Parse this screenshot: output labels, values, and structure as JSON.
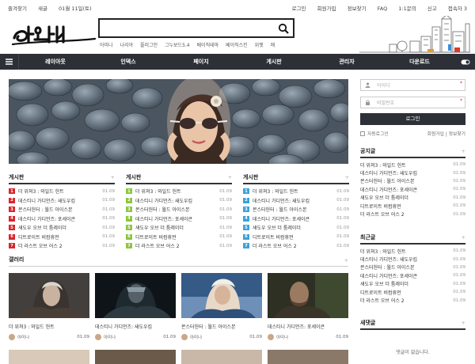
{
  "topbar": {
    "left": [
      "즐겨찾기",
      "새글",
      "01월 11일(토)"
    ],
    "right": [
      "로그인",
      "회원가입",
      "정보찾기",
      "FAQ",
      "1:1문의",
      "신고",
      "접속자 3"
    ]
  },
  "header": {
    "logo_text": "아미나",
    "keywords": [
      "아미나",
      "나리야",
      "플러그인",
      "그누보드5.4",
      "베이직테마",
      "베이직스킨",
      "위젯",
      "애"
    ]
  },
  "nav": {
    "items": [
      "레이아웃",
      "인덱스",
      "페이지",
      "게시판",
      "관리자",
      "다운로드"
    ]
  },
  "board_columns": [
    {
      "title": "게시판",
      "color": "#d9262c",
      "posts": [
        {
          "n": "1",
          "title": "더 위쳐3 : 와일드 헌트",
          "date": "01.09"
        },
        {
          "n": "2",
          "title": "데스티니 가디언즈: 새도우킵",
          "date": "01.09"
        },
        {
          "n": "3",
          "title": "몬스터헌터 : 월드 아이스본",
          "date": "01.09"
        },
        {
          "n": "4",
          "title": "데스티니 가디언즈: 포세이큰",
          "date": "01.09"
        },
        {
          "n": "5",
          "title": "섀도우 오브 더 툼레이더",
          "date": "01.09"
        },
        {
          "n": "6",
          "title": "디트로이트 비컴휴먼",
          "date": "01.09"
        },
        {
          "n": "7",
          "title": "더 라스트 오브 어스 2",
          "date": "01.09"
        }
      ]
    },
    {
      "title": "게시판",
      "color": "#8dc63f",
      "posts": [
        {
          "n": "1",
          "title": "더 위쳐3 : 와일드 헌트",
          "date": "01.09"
        },
        {
          "n": "2",
          "title": "데스티니 가디언즈: 새도우킵",
          "date": "01.09"
        },
        {
          "n": "3",
          "title": "몬스터헌터 : 월드 아이스본",
          "date": "01.09"
        },
        {
          "n": "4",
          "title": "데스티니 가디언즈: 포세이큰",
          "date": "01.09"
        },
        {
          "n": "5",
          "title": "섀도우 오브 더 툼레이더",
          "date": "01.09"
        },
        {
          "n": "6",
          "title": "디트로이트 비컴휴먼",
          "date": "01.09"
        },
        {
          "n": "7",
          "title": "더 라스트 오브 어스 2",
          "date": "01.09"
        }
      ]
    },
    {
      "title": "게시판",
      "color": "#3aa3d8",
      "posts": [
        {
          "n": "1",
          "title": "더 위쳐3 : 와일드 헌트",
          "date": "01.09"
        },
        {
          "n": "2",
          "title": "데스티니 가디언즈: 새도우킵",
          "date": "01.09"
        },
        {
          "n": "3",
          "title": "몬스터헌터 : 월드 아이스본",
          "date": "01.09"
        },
        {
          "n": "4",
          "title": "데스티니 가디언즈: 포세이큰",
          "date": "01.09"
        },
        {
          "n": "5",
          "title": "섀도우 오브 더 툼레이더",
          "date": "01.09"
        },
        {
          "n": "6",
          "title": "디트로이트 비컴휴먼",
          "date": "01.09"
        },
        {
          "n": "7",
          "title": "더 라스트 오브 어스 2",
          "date": "01.09"
        }
      ]
    }
  ],
  "gallery": {
    "title": "갤러리",
    "cards": [
      {
        "caption": "더 위쳐3 : 와일드 헌트",
        "user": "아미나",
        "date": "01.09"
      },
      {
        "caption": "데스티니 가디언즈: 새도우킵",
        "user": "아미나",
        "date": "01.09"
      },
      {
        "caption": "몬스터헌터 : 월드 아이스본",
        "user": "아미나",
        "date": "01.09"
      },
      {
        "caption": "데스티니 가디언즈: 포세이큰",
        "user": "아미나",
        "date": "01.09"
      }
    ]
  },
  "login": {
    "id_placeholder": "아이디",
    "pw_placeholder": "비밀번호",
    "button": "로그인",
    "auto_login": "자동로그인",
    "join": "회원가입",
    "find": "정보찾기"
  },
  "notice": {
    "title": "공지글",
    "posts": [
      {
        "title": "더 위쳐3 : 와일드 헌트",
        "date": "01.09"
      },
      {
        "title": "데스티니 가디언즈: 새도우킵",
        "date": "01.09"
      },
      {
        "title": "몬스터헌터 : 월드 아이스본",
        "date": "01.09"
      },
      {
        "title": "데스티니 가디언즈: 포세이큰",
        "date": "01.09"
      },
      {
        "title": "섀도우 오브 더 툼레이더",
        "date": "01.09"
      },
      {
        "title": "디트로이트 비컴휴먼",
        "date": "01.09"
      },
      {
        "title": "더 라스트 오브 어스 2",
        "date": "01.09"
      }
    ]
  },
  "recent": {
    "title": "최근글",
    "posts": [
      {
        "title": "더 위쳐3 : 와일드 헌트",
        "date": "01.09"
      },
      {
        "title": "데스티니 가디언즈: 새도우킵",
        "date": "01.09"
      },
      {
        "title": "몬스터헌터 : 월드 아이스본",
        "date": "01.09"
      },
      {
        "title": "데스티니 가디언즈: 포세이큰",
        "date": "01.09"
      },
      {
        "title": "섀도우 오브 더 툼레이더",
        "date": "01.09"
      },
      {
        "title": "디트로이트 비컴휴먼",
        "date": "01.09"
      },
      {
        "title": "더 라스트 오브 어스 2",
        "date": "01.09"
      }
    ]
  },
  "comments": {
    "title": "새댓글",
    "empty": "댓글이 없습니다."
  }
}
